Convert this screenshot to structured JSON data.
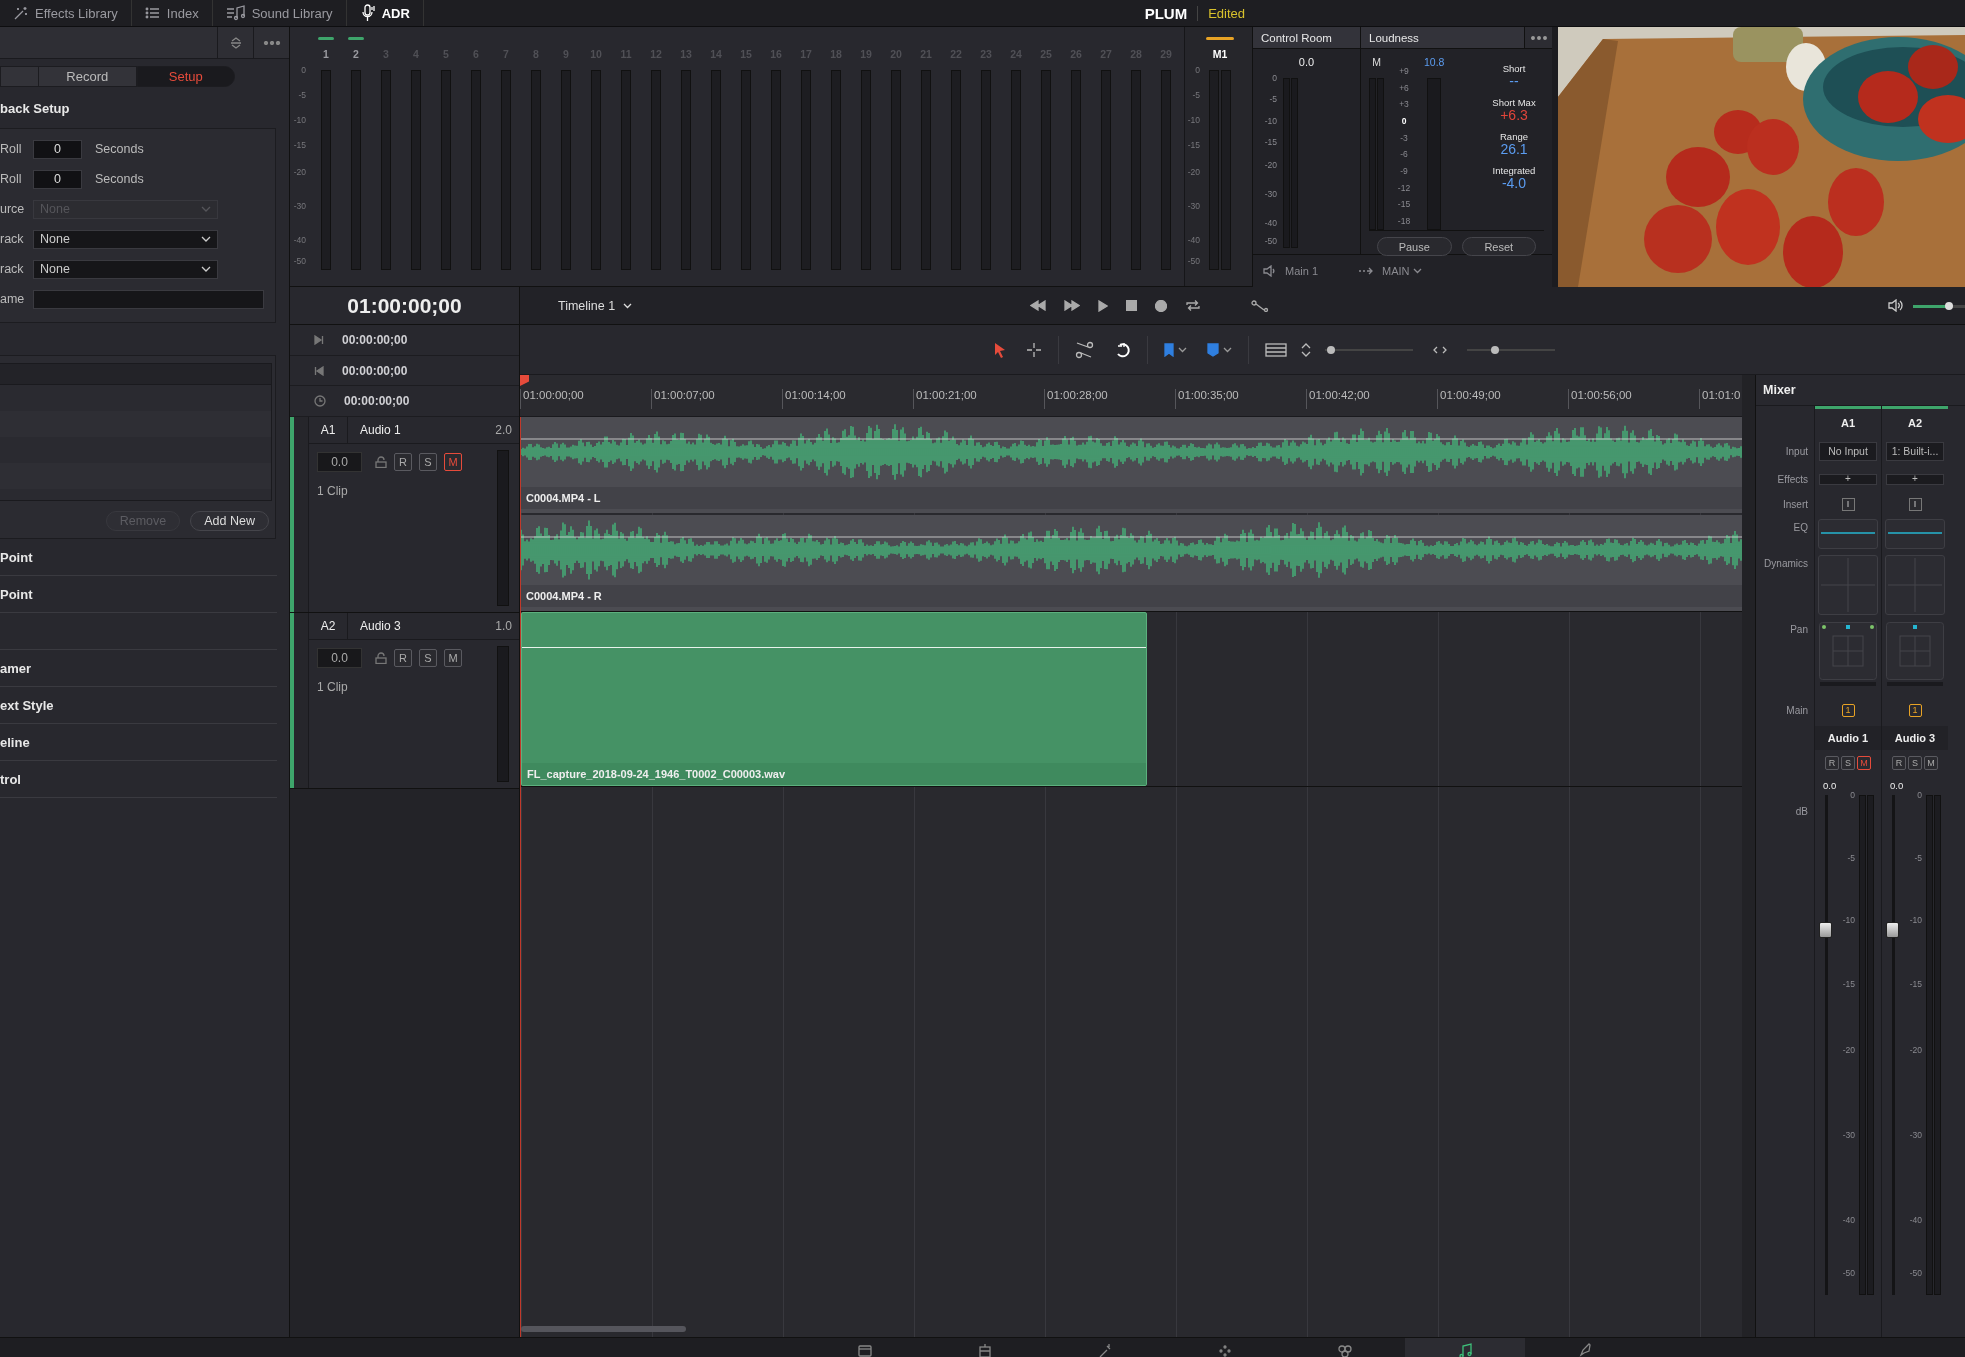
{
  "top_tabs": [
    {
      "kind": "effects",
      "label": "Effects Library",
      "selected": false
    },
    {
      "kind": "index",
      "label": "Index",
      "selected": false
    },
    {
      "kind": "sound",
      "label": "Sound Library",
      "selected": false
    },
    {
      "kind": "adr",
      "label": "ADR",
      "selected": true
    }
  ],
  "project": {
    "name": "PLUM",
    "status": "Edited"
  },
  "adr": {
    "tabs": [
      {
        "label": "Record",
        "selected": false
      },
      {
        "label": "Setup",
        "selected": true
      }
    ],
    "title": "back Setup",
    "fields": [
      {
        "kind": "number",
        "label": "Roll",
        "value": "0",
        "unit": "Seconds"
      },
      {
        "kind": "number",
        "label": "Roll",
        "value": "0",
        "unit": "Seconds"
      },
      {
        "kind": "dropdown",
        "label": "urce",
        "value": "None",
        "disabled": true
      },
      {
        "kind": "dropdown",
        "label": "rack",
        "value": "None",
        "disabled": false
      },
      {
        "kind": "dropdown",
        "label": "rack",
        "value": "None",
        "disabled": false
      },
      {
        "kind": "text",
        "label": "ame"
      }
    ],
    "buttons": [
      {
        "label": "Remove",
        "disabled": true
      },
      {
        "label": "Add New",
        "disabled": false
      }
    ],
    "sections": [
      "Point",
      "Point",
      "amer",
      "ext Style",
      "eline",
      "trol"
    ]
  },
  "meter_bridge": {
    "scale": [
      "0",
      "-5",
      "-10",
      "-15",
      "-20",
      "-30",
      "-40",
      "-50"
    ],
    "channels": [
      {
        "label": "1",
        "active": true
      },
      {
        "label": "2",
        "active": true
      },
      {
        "label": "3",
        "active": false
      },
      {
        "label": "4",
        "active": false
      },
      {
        "label": "5",
        "active": false
      },
      {
        "label": "6",
        "active": false
      },
      {
        "label": "7",
        "active": false
      },
      {
        "label": "8",
        "active": false
      },
      {
        "label": "9",
        "active": false
      },
      {
        "label": "10",
        "active": false
      },
      {
        "label": "11",
        "active": false
      },
      {
        "label": "12",
        "active": false
      },
      {
        "label": "13",
        "active": false
      },
      {
        "label": "14",
        "active": false
      },
      {
        "label": "15",
        "active": false
      },
      {
        "label": "16",
        "active": false
      },
      {
        "label": "17",
        "active": false
      },
      {
        "label": "18",
        "active": false
      },
      {
        "label": "19",
        "active": false
      },
      {
        "label": "20",
        "active": false
      },
      {
        "label": "21",
        "active": false
      },
      {
        "label": "22",
        "active": false
      },
      {
        "label": "23",
        "active": false
      },
      {
        "label": "24",
        "active": false
      },
      {
        "label": "25",
        "active": false
      },
      {
        "label": "26",
        "active": false
      },
      {
        "label": "27",
        "active": false
      },
      {
        "label": "28",
        "active": false
      },
      {
        "label": "29",
        "active": false
      }
    ],
    "master": {
      "label": "M1",
      "scale": [
        "0",
        "-5",
        "-10",
        "-15",
        "-20",
        "-30",
        "-40",
        "-50"
      ]
    }
  },
  "control_room": {
    "title": "Control Room",
    "reading": "0.0",
    "scale": [
      "0",
      "-5",
      "-10",
      "-15",
      "-20",
      "-30",
      "-40",
      "-50"
    ]
  },
  "loudness": {
    "title": "Loudness",
    "meter_label": "M",
    "reading": "10.8",
    "scale": [
      "+9",
      "+6",
      "+3",
      "0",
      "-3",
      "-6",
      "-9",
      "-12",
      "-15",
      "-18"
    ],
    "stats": [
      {
        "label": "Short",
        "value": "--",
        "kind": "normal"
      },
      {
        "label": "Short Max",
        "value": "+6.3",
        "kind": "over"
      },
      {
        "label": "Range",
        "value": "26.1",
        "kind": "normal"
      },
      {
        "label": "Integrated",
        "value": "-4.0",
        "kind": "normal"
      }
    ],
    "buttons": [
      "Pause",
      "Reset"
    ]
  },
  "monitor_route": {
    "output": "Main 1",
    "bus": "MAIN"
  },
  "timeline_header": {
    "timecode": "01:00:00;00",
    "timeline": "Timeline 1",
    "volume": {
      "level": 0.7
    }
  },
  "timecodes": [
    {
      "kind": "in",
      "value": "00:00:00;00"
    },
    {
      "kind": "out",
      "value": "00:00:00;00"
    },
    {
      "kind": "duration",
      "value": "00:00:00;00"
    }
  ],
  "tools": [
    {
      "kind": "pointer",
      "selected": true
    },
    {
      "kind": "range",
      "selected": false
    }
  ],
  "zoom_sliders": [
    {
      "level": 0.02
    },
    {
      "level": 0.3
    }
  ],
  "ruler": [
    "01:00:00;00",
    "01:00:07;00",
    "01:00:14;00",
    "01:00:21;00",
    "01:00:28;00",
    "01:00:35;00",
    "01:00:42;00",
    "01:00:49;00",
    "01:00:56;00",
    "01:01:0"
  ],
  "tracks": [
    {
      "id": "A1",
      "name": "Audio 1",
      "format": "2.0",
      "volume": "0.0",
      "buttons": [
        {
          "label": "R",
          "on": false
        },
        {
          "label": "S",
          "on": false
        },
        {
          "label": "M",
          "on": true
        }
      ],
      "clip_count": "1 Clip",
      "clips": [
        {
          "kind": "waveform",
          "name": "C0004.MP4 - L"
        },
        {
          "kind": "waveform",
          "name": "C0004.MP4 - R"
        }
      ]
    },
    {
      "id": "A2",
      "name": "Audio 3",
      "format": "1.0",
      "volume": "0.0",
      "buttons": [
        {
          "label": "R",
          "on": false
        },
        {
          "label": "S",
          "on": false
        },
        {
          "label": "M",
          "on": false
        }
      ],
      "clip_count": "1 Clip",
      "clips": [
        {
          "kind": "flat",
          "name": "FL_capture_2018-09-24_1946_T0002_C00003.wav"
        }
      ]
    }
  ],
  "mixer": {
    "title": "Mixer",
    "rows": [
      "Input",
      "Effects",
      "Insert",
      "EQ",
      "Dynamics",
      "Pan",
      "Main",
      "dB"
    ],
    "strips": [
      {
        "id": "A1",
        "kind": "stereo",
        "input": "No Input",
        "effects": "+",
        "insert": "I",
        "main": "1",
        "name": "Audio 1",
        "buttons": [
          {
            "label": "R",
            "on": false
          },
          {
            "label": "S",
            "on": false
          },
          {
            "label": "M",
            "on": true
          }
        ],
        "volume": "0.0",
        "level": 0.73,
        "scale": [
          "0",
          "-5",
          "-10",
          "-15",
          "-20",
          "-30",
          "-40",
          "-50"
        ]
      },
      {
        "id": "A2",
        "kind": "mono",
        "input": "1: Built-i...",
        "effects": "+",
        "insert": "I",
        "main": "1",
        "name": "Audio 3",
        "buttons": [
          {
            "label": "R",
            "on": false
          },
          {
            "label": "S",
            "on": false
          },
          {
            "label": "M",
            "on": false
          }
        ],
        "volume": "0.0",
        "level": 0.73,
        "scale": [
          "0",
          "-5",
          "-10",
          "-15",
          "-20",
          "-30",
          "-40",
          "-50"
        ]
      }
    ]
  },
  "pages": [
    {
      "kind": "media",
      "selected": false
    },
    {
      "kind": "cut",
      "selected": false
    },
    {
      "kind": "edit",
      "selected": false
    },
    {
      "kind": "fusion",
      "selected": false
    },
    {
      "kind": "color",
      "selected": false
    },
    {
      "kind": "fairlight",
      "selected": true
    },
    {
      "kind": "deliver",
      "selected": false
    }
  ]
}
